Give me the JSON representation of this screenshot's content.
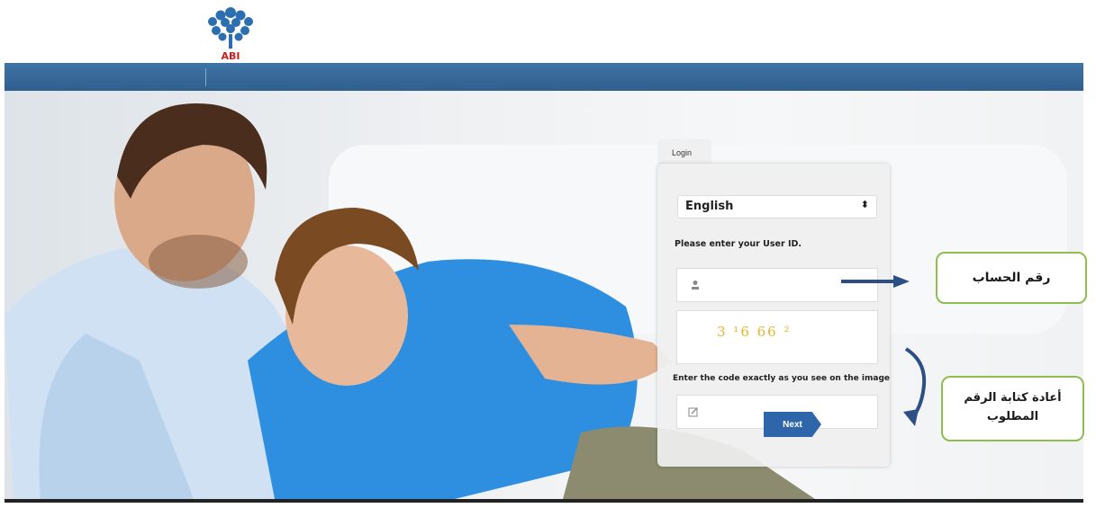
{
  "brand": {
    "logo_name": "ABI bank emblem",
    "primary_color": "#2f5f8d",
    "button_color": "#2f66a9",
    "captcha_color": "#e8b42a",
    "annotation_border_color": "#8fbd4f"
  },
  "login": {
    "tab_label": "Login",
    "language_selected": "English",
    "user_id_prompt": "Please enter your User ID.",
    "user_id_value": "",
    "captcha_text": "3 ¹6 66 ²",
    "code_prompt": "Enter the code exactly as you see on the image",
    "code_value": "",
    "next_label": "Next"
  },
  "annotations": {
    "account_number": "رقم الحساب",
    "retype_code": "أعادة كتابة الرقم المطلوب"
  }
}
